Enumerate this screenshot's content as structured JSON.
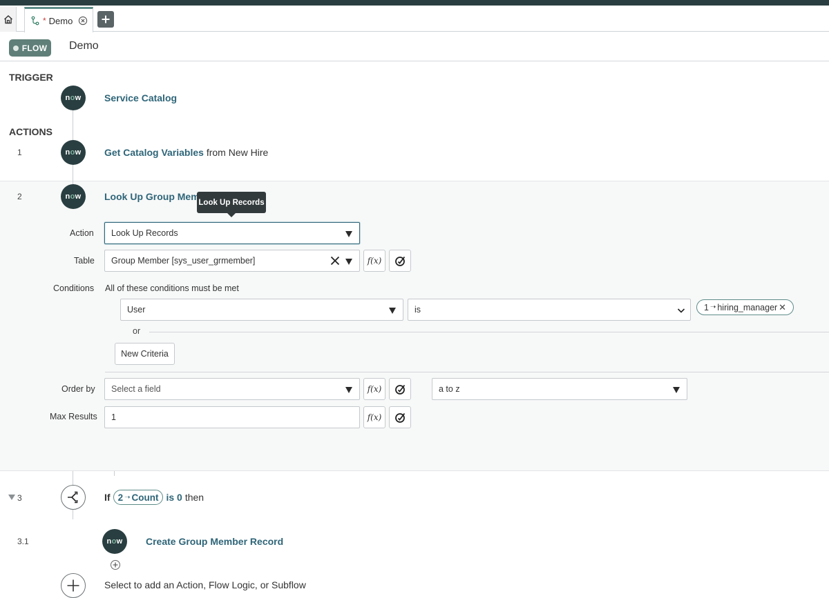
{
  "tabs": {
    "home_icon": "home-icon",
    "active": {
      "dirty_mark": "*",
      "label": "Demo"
    },
    "add_icon": "plus-icon"
  },
  "header": {
    "badge": "FLOW",
    "title": "Demo"
  },
  "trigger": {
    "section_label": "TRIGGER",
    "icon_text": "now",
    "title": "Service Catalog"
  },
  "actions": {
    "section_label": "ACTIONS",
    "items": [
      {
        "number": "1",
        "icon_text": "now",
        "title": "Get Catalog Variables",
        "suffix": "from New Hire"
      },
      {
        "number": "2",
        "icon_text": "now",
        "title": "Look Up Group Member Records",
        "tooltip": "Look Up Records"
      }
    ]
  },
  "step2_form": {
    "action_label": "Action",
    "action_value": "Look Up Records",
    "table_label": "Table",
    "table_value": "Group Member [sys_user_grmember]",
    "conditions_label": "Conditions",
    "conditions_text": "All of these conditions must be met",
    "condition_field": "User",
    "condition_operator": "is",
    "condition_pill_step": "1",
    "condition_pill_arrow": "➝",
    "condition_pill_value": "hiring_manager",
    "or_label": "or",
    "new_criteria_label": "New Criteria",
    "order_by_label": "Order by",
    "order_by_placeholder": "Select a field",
    "order_direction": "a to z",
    "max_results_label": "Max Results",
    "max_results_value": "1",
    "fx_label": "f(x)"
  },
  "step3": {
    "number": "3",
    "if_label": "If",
    "pill_step": "2",
    "pill_arrow": "➝",
    "pill_value": "Count",
    "condition": "is 0",
    "then": "then"
  },
  "step31": {
    "number": "3.1",
    "icon_text": "now",
    "title": "Create Group Member Record"
  },
  "add_prompt": "Select to add an Action, Flow Logic, or Subflow"
}
